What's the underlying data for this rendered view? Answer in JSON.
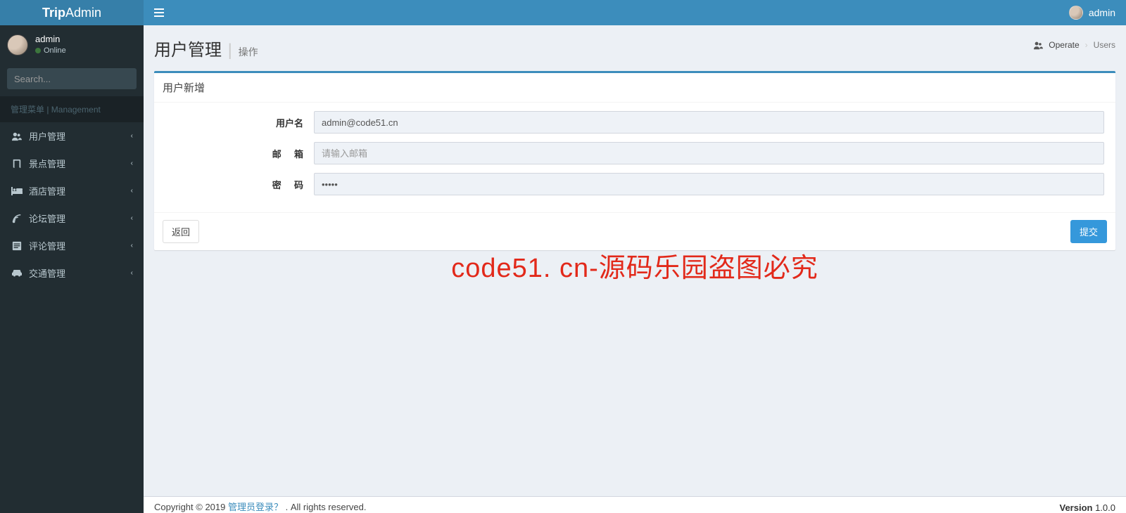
{
  "header": {
    "logo_bold": "Trip",
    "logo_light": "Admin",
    "top_user": "admin"
  },
  "sidebar": {
    "user_name": "admin",
    "user_status": "Online",
    "search_placeholder": "Search...",
    "section_header": "管理菜单 | Management",
    "items": [
      {
        "label": "用户管理"
      },
      {
        "label": "景点管理"
      },
      {
        "label": "酒店管理"
      },
      {
        "label": "论坛管理"
      },
      {
        "label": "评论管理"
      },
      {
        "label": "交通管理"
      }
    ]
  },
  "page": {
    "title": "用户管理",
    "subtitle": "操作",
    "breadcrumb": {
      "operate": "Operate",
      "users": "Users"
    }
  },
  "box": {
    "title": "用户新增",
    "fields": {
      "username_label": "用户名",
      "username_value": "admin@code51.cn",
      "email_label_a": "邮",
      "email_label_b": "箱",
      "email_placeholder": "请输入邮箱",
      "password_label_a": "密",
      "password_label_b": "码",
      "password_value": "•••••"
    },
    "back_btn": "返回",
    "submit_btn": "提交"
  },
  "watermark": "code51. cn-源码乐园盗图必究",
  "footer": {
    "copyright_prefix": "Copyright © 2019 ",
    "link": "管理员登录？",
    "rights": " . All rights reserved.",
    "version_label": "Version",
    "version_value": " 1.0.0"
  }
}
